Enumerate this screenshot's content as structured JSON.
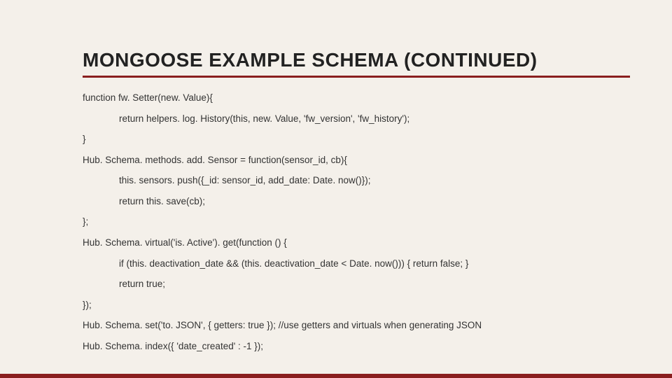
{
  "slide": {
    "title": "MONGOOSE EXAMPLE SCHEMA (CONTINUED)",
    "code": {
      "l0": "function fw. Setter(new. Value){",
      "l1": "return helpers. log. History(this, new. Value, 'fw_version', 'fw_history');",
      "l2": "}",
      "l3": "Hub. Schema. methods. add. Sensor = function(sensor_id, cb){",
      "l4": "this. sensors. push({_id: sensor_id, add_date: Date. now()});",
      "l5": "return this. save(cb);",
      "l6": "};",
      "l7": "Hub. Schema. virtual('is. Active'). get(function () {",
      "l8": "if (this. deactivation_date && (this. deactivation_date < Date. now())) { return false; }",
      "l9": "return true;",
      "l10": "});",
      "l11": "Hub. Schema. set('to. JSON', { getters: true }); //use getters and virtuals when generating JSON",
      "l12": "Hub. Schema. index({ 'date_created'  : -1 });"
    }
  }
}
